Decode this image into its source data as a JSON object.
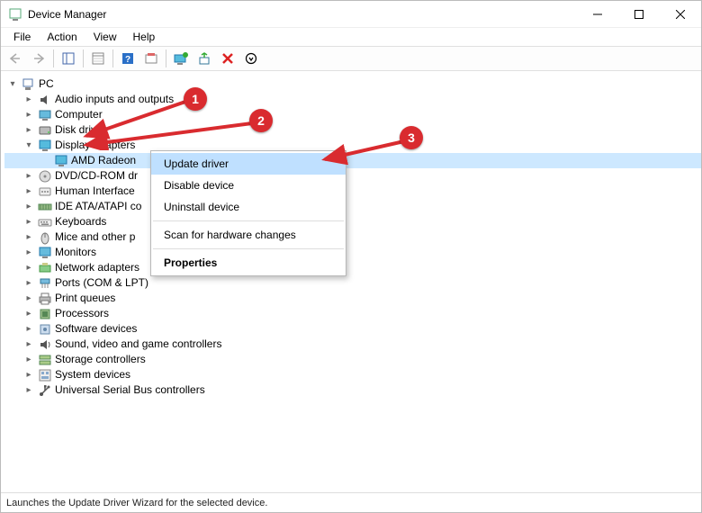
{
  "window": {
    "title": "Device Manager"
  },
  "menu": {
    "file": "File",
    "action": "Action",
    "view": "View",
    "help": "Help"
  },
  "status": "Launches the Update Driver Wizard for the selected device.",
  "tree": {
    "root": "PC",
    "items": [
      {
        "label": "Audio inputs and outputs",
        "icon": "audio"
      },
      {
        "label": "Computer",
        "icon": "computer"
      },
      {
        "label": "Disk drives",
        "icon": "disk"
      },
      {
        "label": "Display adapters",
        "icon": "display",
        "expanded": true,
        "children": [
          {
            "label": "AMD Radeon",
            "icon": "display",
            "selected": true
          }
        ]
      },
      {
        "label": "DVD/CD-ROM dr",
        "icon": "dvd"
      },
      {
        "label": "Human Interface",
        "icon": "hid"
      },
      {
        "label": "IDE ATA/ATAPI co",
        "icon": "ide"
      },
      {
        "label": "Keyboards",
        "icon": "keyboard"
      },
      {
        "label": "Mice and other p",
        "icon": "mouse"
      },
      {
        "label": "Monitors",
        "icon": "monitor"
      },
      {
        "label": "Network adapters",
        "icon": "network"
      },
      {
        "label": "Ports (COM & LPT)",
        "icon": "port"
      },
      {
        "label": "Print queues",
        "icon": "printer"
      },
      {
        "label": "Processors",
        "icon": "cpu"
      },
      {
        "label": "Software devices",
        "icon": "software"
      },
      {
        "label": "Sound, video and game controllers",
        "icon": "sound"
      },
      {
        "label": "Storage controllers",
        "icon": "storage"
      },
      {
        "label": "System devices",
        "icon": "system"
      },
      {
        "label": "Universal Serial Bus controllers",
        "icon": "usb"
      }
    ]
  },
  "context_menu": {
    "update": "Update driver",
    "disable": "Disable device",
    "uninstall": "Uninstall device",
    "scan": "Scan for hardware changes",
    "properties": "Properties"
  },
  "annotations": {
    "b1": "1",
    "b2": "2",
    "b3": "3"
  }
}
